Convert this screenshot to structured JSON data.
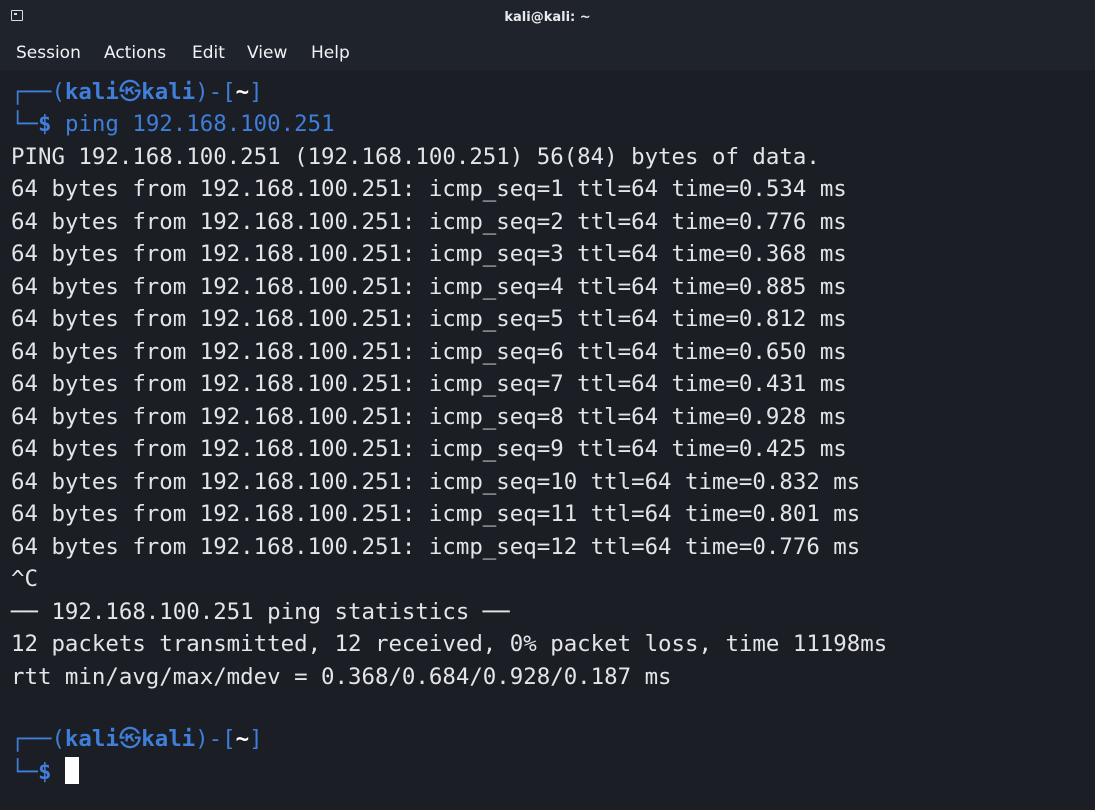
{
  "window": {
    "title": "kali@kali: ~"
  },
  "menubar": {
    "items": [
      "Session",
      "Actions",
      "Edit",
      "View",
      "Help"
    ]
  },
  "prompt": {
    "frame_top": "┌──(",
    "user": "kali",
    "at_glyph": "㉿",
    "host": "kali",
    "close_open": ")-[",
    "path": "~",
    "close": "]",
    "frame_bottom": "└─",
    "symbol": "$"
  },
  "command": "ping 192.168.100.251",
  "output": [
    "PING 192.168.100.251 (192.168.100.251) 56(84) bytes of data.",
    "64 bytes from 192.168.100.251: icmp_seq=1 ttl=64 time=0.534 ms",
    "64 bytes from 192.168.100.251: icmp_seq=2 ttl=64 time=0.776 ms",
    "64 bytes from 192.168.100.251: icmp_seq=3 ttl=64 time=0.368 ms",
    "64 bytes from 192.168.100.251: icmp_seq=4 ttl=64 time=0.885 ms",
    "64 bytes from 192.168.100.251: icmp_seq=5 ttl=64 time=0.812 ms",
    "64 bytes from 192.168.100.251: icmp_seq=6 ttl=64 time=0.650 ms",
    "64 bytes from 192.168.100.251: icmp_seq=7 ttl=64 time=0.431 ms",
    "64 bytes from 192.168.100.251: icmp_seq=8 ttl=64 time=0.928 ms",
    "64 bytes from 192.168.100.251: icmp_seq=9 ttl=64 time=0.425 ms",
    "64 bytes from 192.168.100.251: icmp_seq=10 ttl=64 time=0.832 ms",
    "64 bytes from 192.168.100.251: icmp_seq=11 ttl=64 time=0.801 ms",
    "64 bytes from 192.168.100.251: icmp_seq=12 ttl=64 time=0.776 ms",
    "^C",
    "── 192.168.100.251 ping statistics ──",
    "12 packets transmitted, 12 received, 0% packet loss, time 11198ms",
    "rtt min/avg/max/mdev = 0.368/0.684/0.928/0.187 ms"
  ],
  "colors": {
    "background": "#1b1e25",
    "prompt_blue": "#3f7ed9",
    "text": "#e3e5e8"
  }
}
